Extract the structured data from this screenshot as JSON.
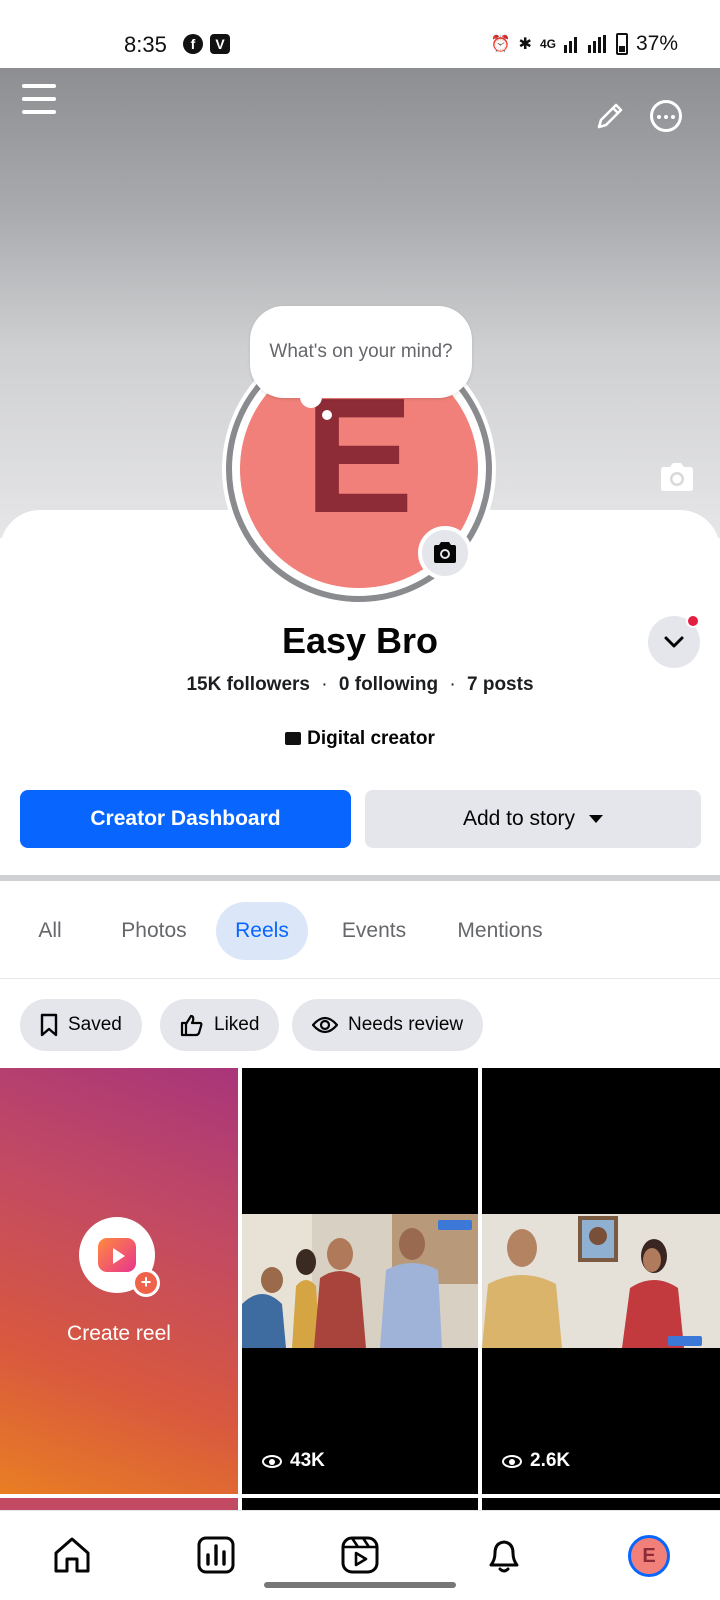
{
  "status_bar": {
    "time": "8:35",
    "apps": [
      "f",
      "V"
    ],
    "network": "4G",
    "battery": "37%"
  },
  "cover": {
    "menu_icon": "hamburger-icon",
    "edit_icon": "pencil-icon",
    "more_icon": "more-dots-icon",
    "camera_icon": "camera-icon"
  },
  "profile": {
    "thought_bubble": "What's on your mind?",
    "avatar_letter": "E",
    "name": "Easy Bro",
    "followers": "15K followers",
    "following": "0 following",
    "posts": "7 posts",
    "separator": "·",
    "category": "Digital creator"
  },
  "actions": {
    "primary": "Creator Dashboard",
    "secondary": "Add to story"
  },
  "tabs": [
    {
      "label": "All",
      "active": false
    },
    {
      "label": "Photos",
      "active": false
    },
    {
      "label": "Reels",
      "active": true
    },
    {
      "label": "Events",
      "active": false
    },
    {
      "label": "Mentions",
      "active": false
    }
  ],
  "chips": [
    {
      "label": "Saved",
      "icon": "bookmark-icon"
    },
    {
      "label": "Liked",
      "icon": "thumbs-up-icon"
    },
    {
      "label": "Needs review",
      "icon": "eye-icon"
    }
  ],
  "grid": {
    "create_label": "Create reel",
    "reels": [
      {
        "views": "43K"
      },
      {
        "views": "2.6K"
      }
    ]
  },
  "bottom_nav": {
    "items": [
      "home-icon",
      "dashboard-icon",
      "video-icon",
      "bell-icon",
      "profile-avatar"
    ],
    "avatar_letter": "E"
  },
  "colors": {
    "accent": "#0866ff",
    "avatar_bg": "#f08079",
    "avatar_letter": "#8d2c36"
  }
}
